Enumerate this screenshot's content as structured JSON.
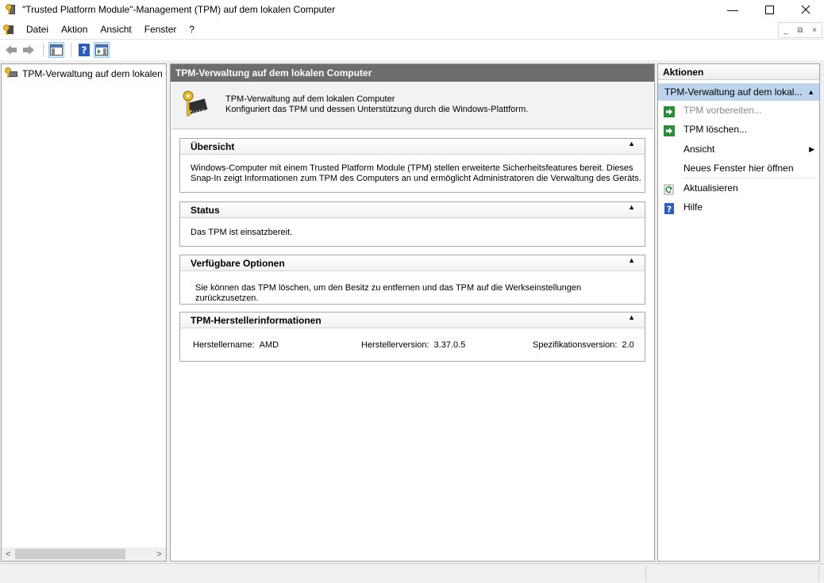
{
  "window": {
    "title": "\"Trusted Platform Module\"-Management (TPM) auf dem lokalen Computer",
    "minimize": "—",
    "maximize": "☐",
    "close": "✕"
  },
  "menu": {
    "items": [
      "Datei",
      "Aktion",
      "Ansicht",
      "Fenster",
      "?"
    ],
    "mdi_min": "_",
    "mdi_restore": "⧉",
    "mdi_close": "×"
  },
  "tree": {
    "root_label": "TPM-Verwaltung auf dem lokalen Computer",
    "scroll_left": "<",
    "scroll_right": ">"
  },
  "center": {
    "header": "TPM-Verwaltung auf dem lokalen Computer",
    "intro_title": "TPM-Verwaltung auf dem lokalen Computer",
    "intro_desc": "Konfiguriert das TPM und dessen Unterstützung durch die Windows-Plattform.",
    "collapse_glyph": "▲",
    "sections": {
      "overview": {
        "title": "Übersicht",
        "line1": "Windows-Computer mit einem Trusted Platform Module (TPM) stellen erweiterte Sicherheitsfeatures bereit. Dieses",
        "line2": "Snap-In zeigt Informationen zum TPM des Computers an und ermöglicht Administratoren die Verwaltung des Geräts."
      },
      "status": {
        "title": "Status",
        "text": "Das TPM ist einsatzbereit."
      },
      "options": {
        "title": "Verfügbare Optionen",
        "text": "Sie können das TPM löschen, um den Besitz zu entfernen und das TPM auf die Werkseinstellungen zurückzusetzen."
      },
      "vendor": {
        "title": "TPM-Herstellerinformationen",
        "manufacturer_label": "Herstellername:",
        "manufacturer_value": "AMD",
        "version_label": "Herstellerversion:",
        "version_value": "3.37.0.5",
        "spec_label": "Spezifikationsversion:",
        "spec_value": "2.0"
      }
    }
  },
  "actions": {
    "header": "Aktionen",
    "group_title": "TPM-Verwaltung auf dem lokal...",
    "group_caret": "▲",
    "submenu_arrow": "▶",
    "items": [
      {
        "label": "TPM vorbereiten...",
        "icon": "green-arrow-icon",
        "disabled": true
      },
      {
        "label": "TPM löschen...",
        "icon": "green-arrow-icon",
        "disabled": false
      },
      {
        "label": "Ansicht",
        "icon": "none",
        "disabled": false
      },
      {
        "label": "Neues Fenster hier öffnen",
        "icon": "none",
        "disabled": false
      },
      {
        "label": "Aktualisieren",
        "icon": "refresh-icon",
        "disabled": false
      },
      {
        "label": "Hilfe",
        "icon": "help-icon",
        "disabled": false
      }
    ]
  },
  "colors": {
    "header_gray": "#6d6d6d",
    "selection_blue": "#bcd4ec",
    "action_green": "#2e8b3a",
    "help_blue": "#2c5db8"
  }
}
